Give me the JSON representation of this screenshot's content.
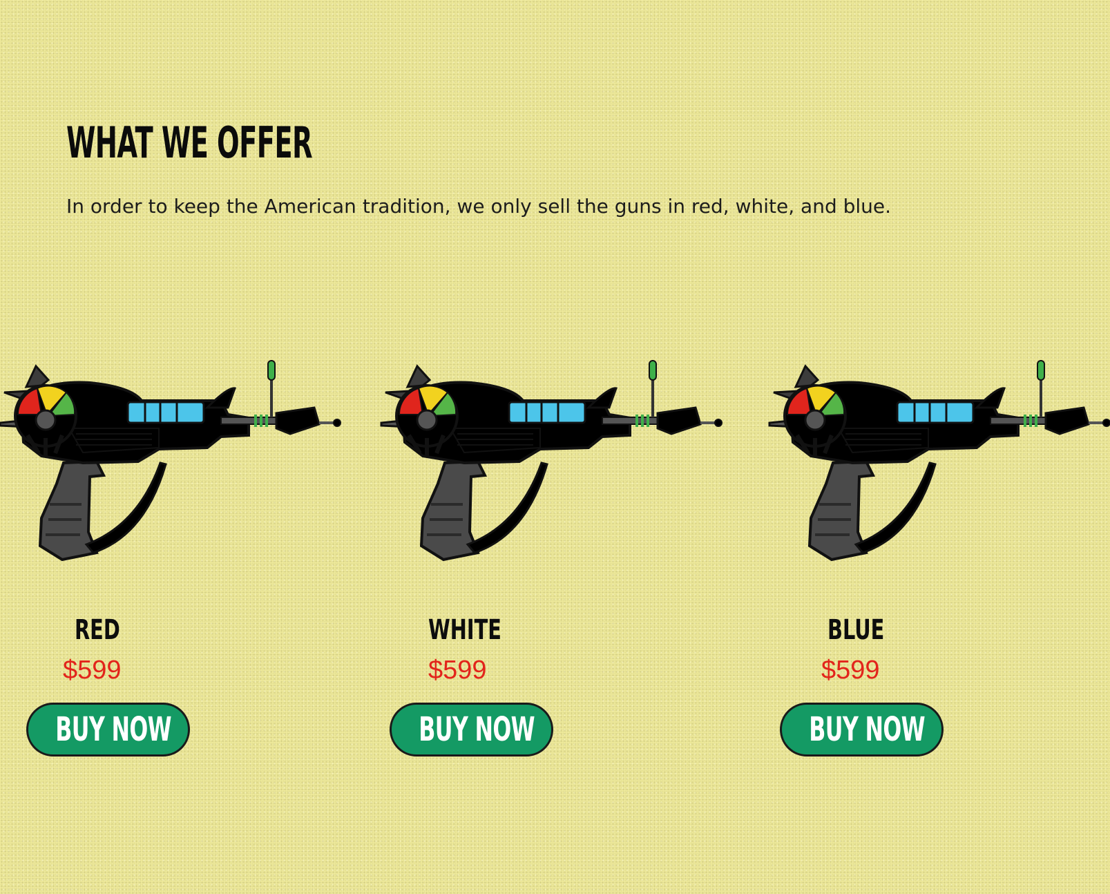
{
  "section": {
    "title": "WHAT WE OFFER",
    "description": "In order to keep the American tradition, we only sell the guns in red, white, and blue."
  },
  "products": [
    {
      "name": "RED",
      "price": "$599",
      "button_label": "BUY NOW",
      "body_color": "#b3151b",
      "body_shade": "#7d0c10"
    },
    {
      "name": "WHITE",
      "price": "$599",
      "button_label": "BUY NOW",
      "body_color": "#eeebe0",
      "body_shade": "#b9b6aa"
    },
    {
      "name": "BLUE",
      "price": "$599",
      "button_label": "BUY NOW",
      "body_color": "#1f4773",
      "body_shade": "#132e4c"
    }
  ],
  "colors": {
    "background": "#f1ec9d",
    "price": "#e2241b",
    "button": "#149a64",
    "tube": "#4cc5ea",
    "grip": "#4a4a4a"
  }
}
